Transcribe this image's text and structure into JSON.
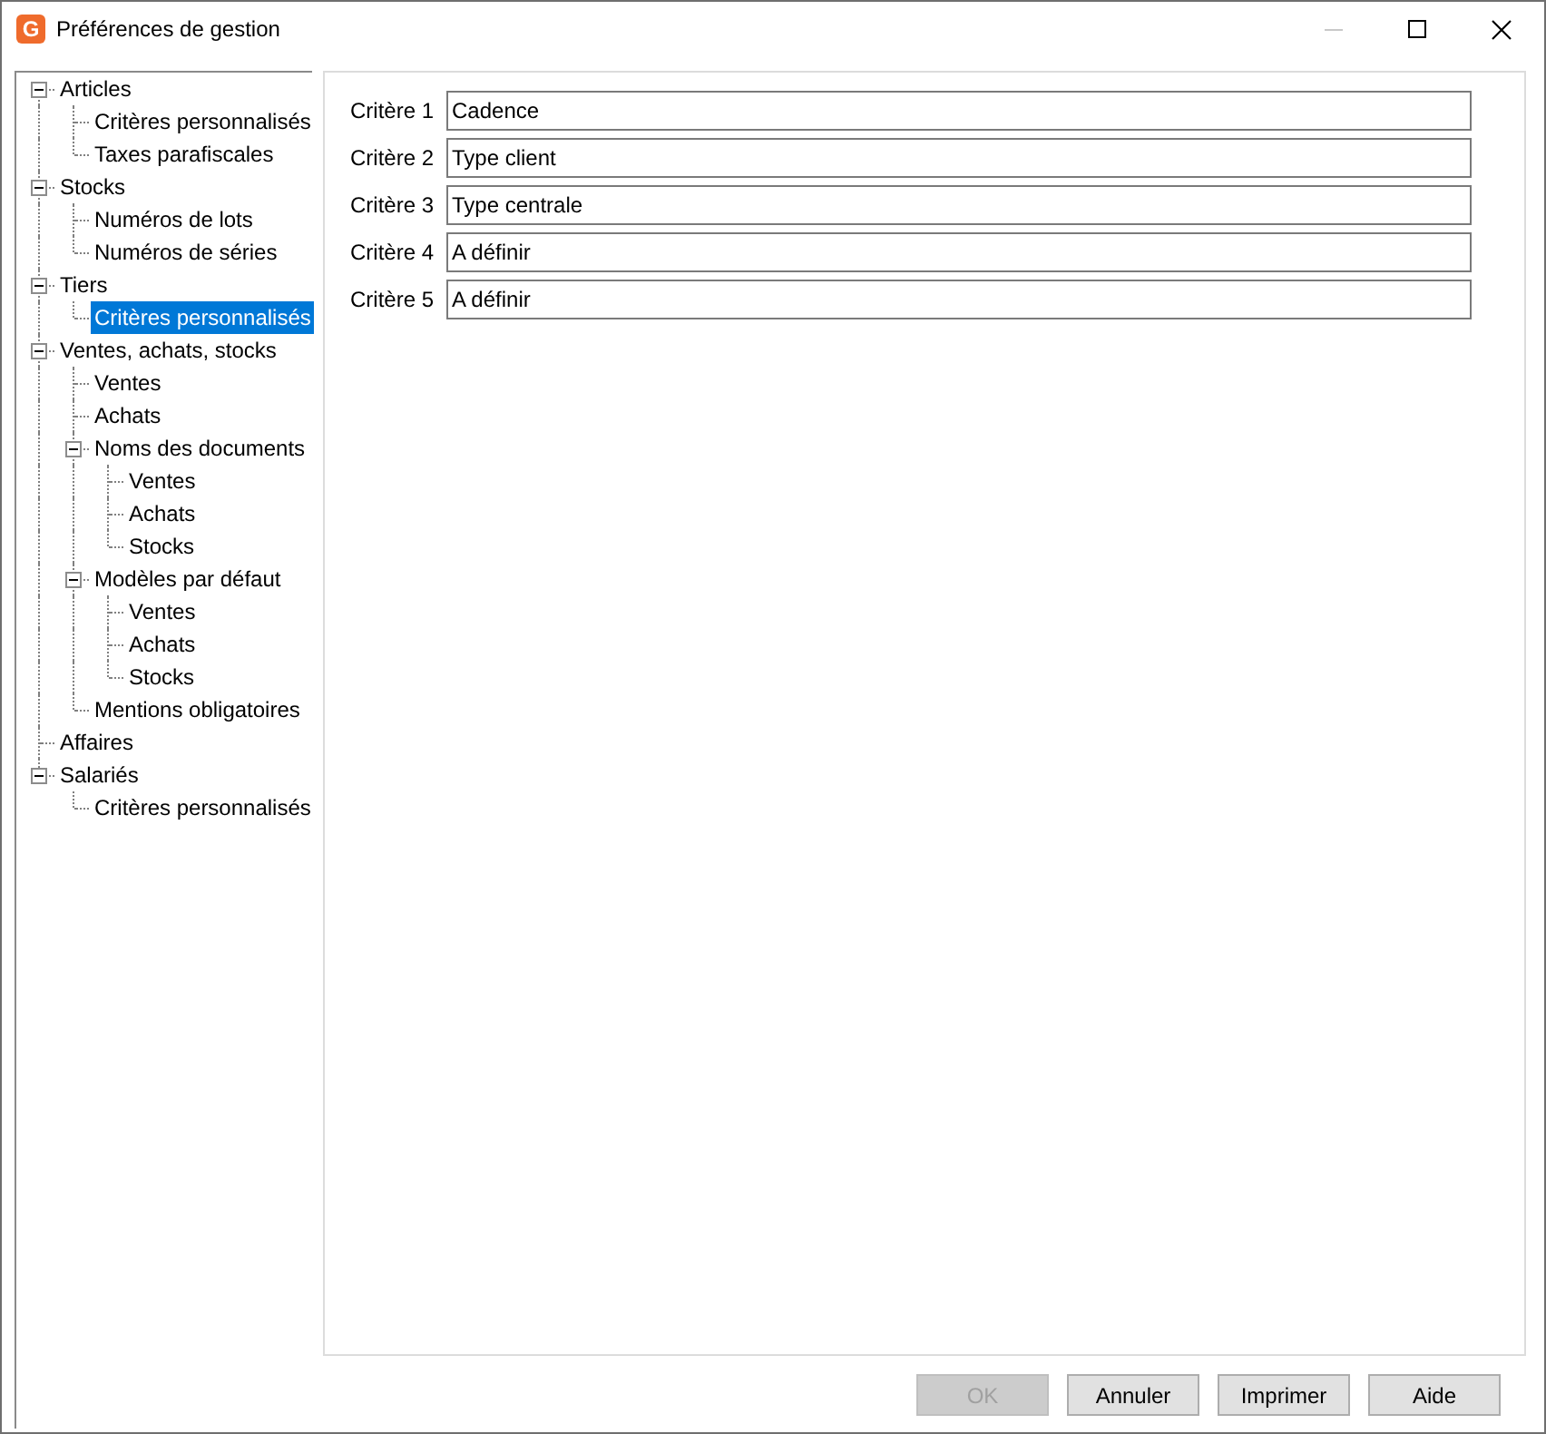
{
  "window": {
    "title": "Préférences de gestion",
    "icon_letter": "G",
    "minimize_disabled": true
  },
  "tree": [
    {
      "label": "Articles",
      "selected": false,
      "expanded": true,
      "children": [
        {
          "label": "Critères personnalisés",
          "selected": false
        },
        {
          "label": "Taxes parafiscales",
          "selected": false
        }
      ]
    },
    {
      "label": "Stocks",
      "selected": false,
      "expanded": true,
      "children": [
        {
          "label": "Numéros de lots",
          "selected": false
        },
        {
          "label": "Numéros de séries",
          "selected": false
        }
      ]
    },
    {
      "label": "Tiers",
      "selected": false,
      "expanded": true,
      "children": [
        {
          "label": "Critères personnalisés",
          "selected": true
        }
      ]
    },
    {
      "label": "Ventes, achats, stocks",
      "selected": false,
      "expanded": true,
      "children": [
        {
          "label": "Ventes",
          "selected": false
        },
        {
          "label": "Achats",
          "selected": false
        },
        {
          "label": "Noms des documents",
          "selected": false,
          "expanded": true,
          "children": [
            {
              "label": "Ventes",
              "selected": false
            },
            {
              "label": "Achats",
              "selected": false
            },
            {
              "label": "Stocks",
              "selected": false
            }
          ]
        },
        {
          "label": "Modèles par défaut",
          "selected": false,
          "expanded": true,
          "children": [
            {
              "label": "Ventes",
              "selected": false
            },
            {
              "label": "Achats",
              "selected": false
            },
            {
              "label": "Stocks",
              "selected": false
            }
          ]
        },
        {
          "label": "Mentions obligatoires",
          "selected": false
        }
      ]
    },
    {
      "label": "Affaires",
      "selected": false
    },
    {
      "label": "Salariés",
      "selected": false,
      "expanded": true,
      "children": [
        {
          "label": "Critères personnalisés",
          "selected": false
        }
      ]
    }
  ],
  "criteria": [
    {
      "label": "Critère 1",
      "value": "Cadence"
    },
    {
      "label": "Critère 2",
      "value": "Type client"
    },
    {
      "label": "Critère 3",
      "value": "Type centrale"
    },
    {
      "label": "Critère 4",
      "value": "A définir"
    },
    {
      "label": "Critère 5",
      "value": "A définir"
    }
  ],
  "buttons": [
    {
      "label": "OK",
      "disabled": true
    },
    {
      "label": "Annuler",
      "disabled": false
    },
    {
      "label": "Imprimer",
      "disabled": false
    },
    {
      "label": "Aide",
      "disabled": false
    }
  ]
}
